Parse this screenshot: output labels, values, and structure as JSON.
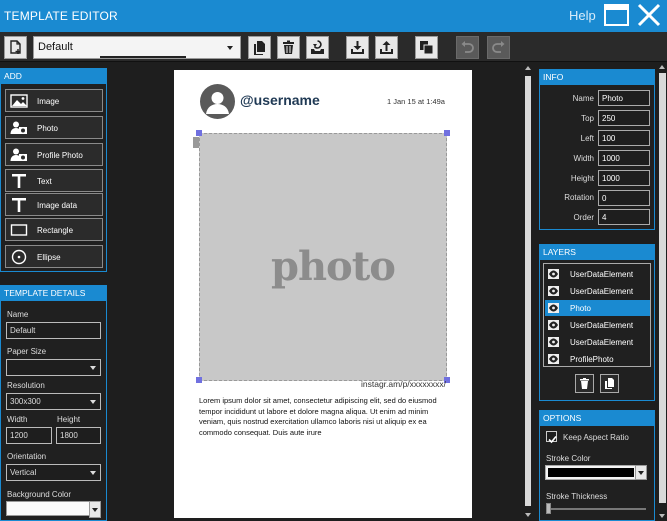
{
  "window": {
    "title": "TEMPLATE EDITOR",
    "help_label": "Help"
  },
  "toolbar": {
    "template_select_value": "Default",
    "buttons": [
      "new-template-icon",
      "copy-icon",
      "delete-icon",
      "save-icon",
      "import-icon",
      "export-icon",
      "duplicate-icon",
      "undo-icon",
      "redo-icon"
    ]
  },
  "add_panel": {
    "header": "ADD",
    "items": [
      {
        "label": "Image",
        "icon": "image-icon"
      },
      {
        "label": "Photo",
        "icon": "photo-icon"
      },
      {
        "label": "Profile Photo",
        "icon": "profile-photo-icon"
      },
      {
        "label": "Text",
        "icon": "text-icon"
      },
      {
        "label": "Image data",
        "icon": "text-icon"
      },
      {
        "label": "Rectangle",
        "icon": "rectangle-icon"
      },
      {
        "label": "Ellipse",
        "icon": "ellipse-icon"
      }
    ]
  },
  "template_details": {
    "header": "TEMPLATE DETAILS",
    "name_label": "Name",
    "name_value": "Default",
    "paper_size_label": "Paper Size",
    "paper_size_value": "",
    "resolution_label": "Resolution",
    "resolution_value": "300x300",
    "width_label": "Width",
    "width_value": "1200",
    "height_label": "Height",
    "height_value": "1800",
    "orientation_label": "Orientation",
    "orientation_value": "Vertical",
    "background_label": "Background Color",
    "background_value": ""
  },
  "canvas": {
    "username": "@username",
    "date": "1 Jan 15 at 1:49a",
    "photo_placeholder": "photo",
    "instagram_url": "instagr.am/p/xxxxxxxx/",
    "caption": "Lorem ipsum dolor sit amet, consectetur adipiscing elit, sed do eiusmod tempor incididunt ut labore et dolore magna aliqua. Ut enim ad minim veniam, quis nostrud exercitation ullamco laboris nisi ut aliquip ex ea commodo consequat. Duis aute irure"
  },
  "info_panel": {
    "header": "INFO",
    "name_label": "Name",
    "name_value": "Photo",
    "top_label": "Top",
    "top_value": "250",
    "left_label": "Left",
    "left_value": "100",
    "width_label": "Width",
    "width_value": "1000",
    "height_label": "Height",
    "height_value": "1000",
    "rotation_label": "Rotation",
    "rotation_value": "0",
    "order_label": "Order",
    "order_value": "4"
  },
  "layers_panel": {
    "header": "LAYERS",
    "items": [
      {
        "label": "UserDataElement",
        "selected": false
      },
      {
        "label": "UserDataElement",
        "selected": false
      },
      {
        "label": "Photo",
        "selected": true
      },
      {
        "label": "UserDataElement",
        "selected": false
      },
      {
        "label": "UserDataElement",
        "selected": false
      },
      {
        "label": "ProfilePhoto",
        "selected": false
      }
    ]
  },
  "options_panel": {
    "header": "OPTIONS",
    "keep_aspect_label": "Keep Aspect Ratio",
    "keep_aspect_checked": true,
    "stroke_color_label": "Stroke Color",
    "stroke_color_value": "#000000",
    "stroke_thickness_label": "Stroke Thickness",
    "stroke_thickness_value": 0
  },
  "colors": {
    "accent": "#1a8ad1",
    "background": "#1e1e1e",
    "selection_handle": "#7070e0"
  }
}
